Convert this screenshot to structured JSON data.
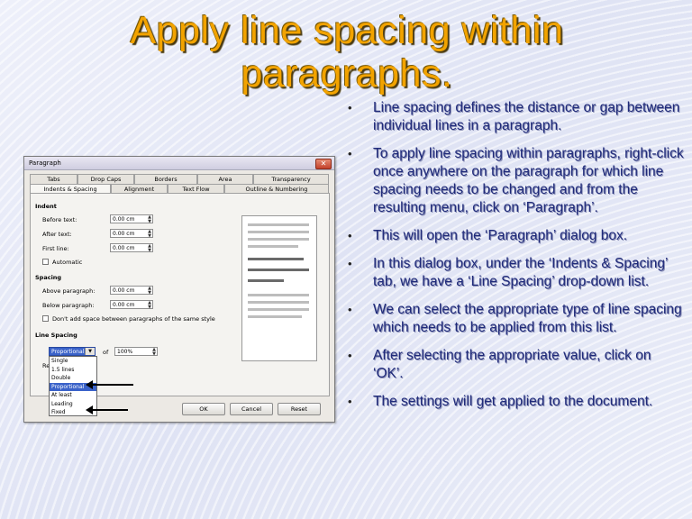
{
  "slide": {
    "title": "Apply line spacing within paragraphs.",
    "bullets": [
      "Line spacing defines the distance or gap between individual lines in a paragraph.",
      "To apply line spacing within paragraphs, right-click once anywhere on the paragraph for which line spacing needs to be changed and from the resulting menu, click on ‘Paragraph’.",
      "This will open the ‘Paragraph’ dialog box.",
      "In this dialog box, under the ‘Indents & Spacing’ tab, we have a ‘Line Spacing’ drop-down list.",
      "We can select the appropriate type of line spacing which needs to be applied from this list.",
      "After selecting the appropriate value, click on ‘OK’.",
      "The settings will get applied to the document."
    ],
    "bullet_glyph": "•"
  },
  "dialog": {
    "title": "Paragraph",
    "close_label": "✕",
    "tabs_row1": [
      "Tabs",
      "Drop Caps",
      "Borders",
      "Area",
      "Transparency"
    ],
    "tabs_row2": [
      "Indents & Spacing",
      "Alignment",
      "Text Flow",
      "Outline & Numbering"
    ],
    "indent": {
      "heading": "Indent",
      "before_label": "Before text:",
      "before_value": "0.00 cm",
      "after_label": "After text:",
      "after_value": "0.00 cm",
      "first_label": "First line:",
      "first_value": "0.00 cm",
      "automatic_label": "Automatic"
    },
    "spacing": {
      "heading": "Spacing",
      "above_label": "Above paragraph:",
      "above_value": "0.00 cm",
      "below_label": "Below paragraph:",
      "below_value": "0.00 cm",
      "dont_add_label": "Don't add space between paragraphs of the same style"
    },
    "line_spacing": {
      "heading": "Line Spacing",
      "selected": "Proportional",
      "of_label": "of",
      "of_value": "100%",
      "options": [
        "Single",
        "1.5 lines",
        "Double",
        "Proportional",
        "At least",
        "Leading",
        "Fixed"
      ],
      "hidden_heading_fragment": "Re"
    },
    "buttons": {
      "ok": "OK",
      "cancel": "Cancel",
      "reset": "Reset"
    }
  },
  "colors": {
    "title": "#f2a300",
    "bullet_text": "#1f2a7a",
    "selection": "#3a62c9"
  }
}
